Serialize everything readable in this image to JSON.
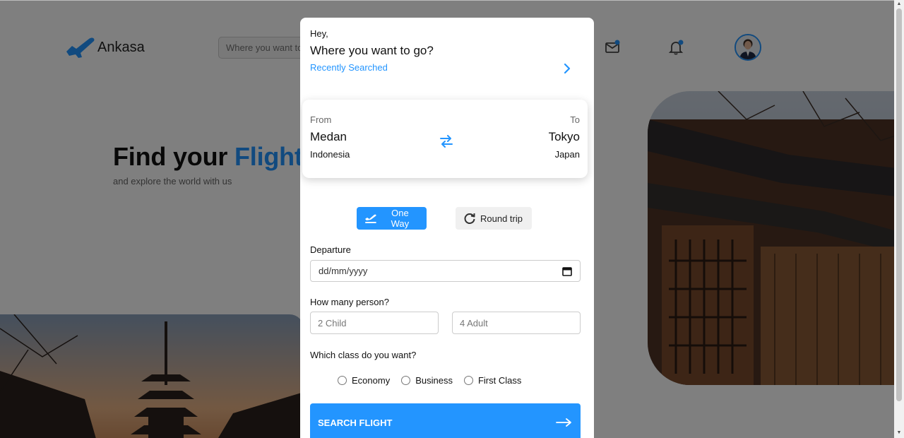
{
  "navbar": {
    "brand": "Ankasa",
    "search_placeholder": "Where you want to go?"
  },
  "hero": {
    "title_part1": "Find your ",
    "title_accent": "Flight",
    "subtitle": "and explore the world with us"
  },
  "modal": {
    "greeting": "Hey,",
    "question": "Where you want to go?",
    "recent_link": "Recently Searched",
    "route": {
      "from_label": "From",
      "from_city": "Medan",
      "from_country": "Indonesia",
      "to_label": "To",
      "to_city": "Tokyo",
      "to_country": "Japan"
    },
    "trip_types": {
      "one_way": "One Way",
      "round_trip": "Round trip",
      "selected": "One Way"
    },
    "departure_label": "Departure",
    "departure_placeholder": "dd/mm/yyyy",
    "persons_label": "How many person?",
    "child_placeholder": "2 Child",
    "adult_placeholder": "4 Adult",
    "class_label": "Which class do you want?",
    "classes": [
      "Economy",
      "Business",
      "First Class"
    ],
    "search_button": "SEARCH FLIGHT"
  },
  "colors": {
    "accent": "#2395ff",
    "overlay": "rgba(0,0,0,0.5)"
  },
  "icons": {
    "logo": "plane-logo-icon",
    "mail": "mail-icon",
    "bell": "bell-icon",
    "swap": "swap-arrows-icon",
    "chevron": "chevron-right-icon",
    "one_way": "plane-takeoff-icon",
    "round_trip": "refresh-icon",
    "calendar": "calendar-icon",
    "arrow": "arrow-right-icon"
  }
}
